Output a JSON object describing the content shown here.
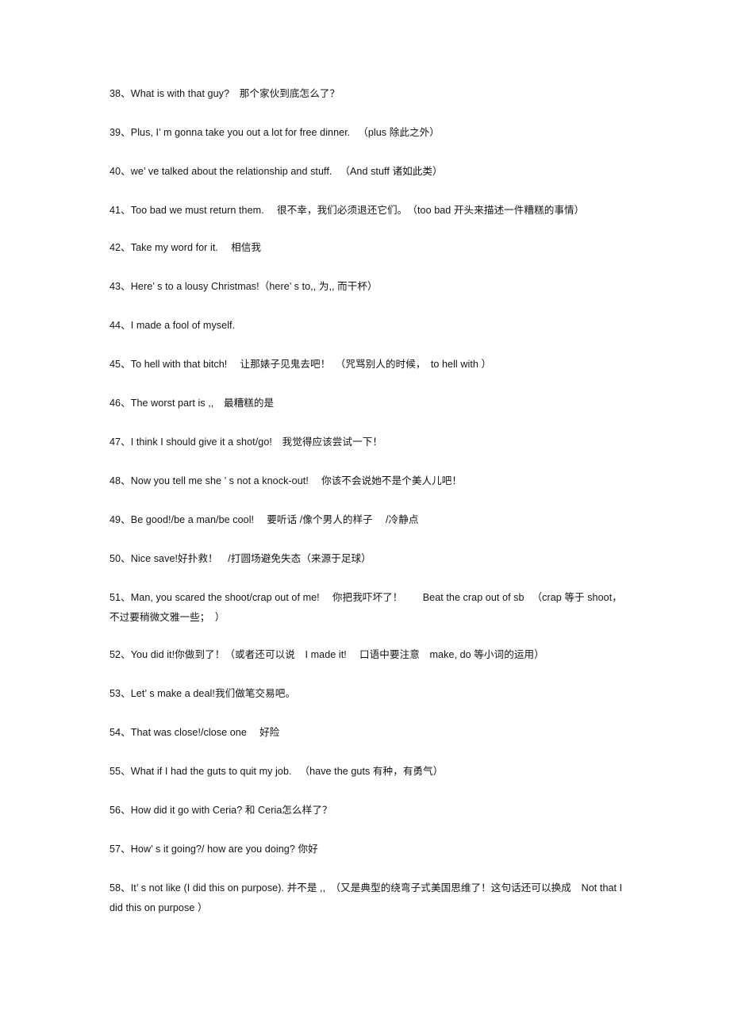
{
  "document": {
    "type": "phrasebook-page",
    "language": "en-zh",
    "background_color": "#ffffff",
    "text_color": "#141414",
    "entries": [
      {
        "number": "38",
        "text": "38、What is with that guy?　那个家伙到底怎么了？"
      },
      {
        "number": "39",
        "text": "39、Plus, I’ m gonna take you out a lot for free dinner. 　（plus 除此之外）"
      },
      {
        "number": "40",
        "text": "40、we’ ve talked about the relationship and stuff. 　（And stuff 诸如此类）"
      },
      {
        "number": "41",
        "text": "41、Too bad we must return them. 　很不幸，我们必须退还它们。　（too bad 开头来描述一件糟糕的事情）"
      },
      {
        "number": "42",
        "text": "42、Take my word for it. 　相信我"
      },
      {
        "number": "43",
        "text": "43、Here’ s to a lousy Christmas!（here’ s to,, 为,, 而干杯）"
      },
      {
        "number": "44",
        "text": "44、I made a fool of myself."
      },
      {
        "number": "45",
        "text": "45、To hell with that bitch! 　让那婊子见鬼去吧！　（咒骂别人的时候，　to hell with ）"
      },
      {
        "number": "46",
        "text": "46、The worst part is ,,　最糟糕的是"
      },
      {
        "number": "47",
        "text": "47、I think I should give it a shot/go!　我觉得应该尝试一下！"
      },
      {
        "number": "48",
        "text": "48、Now you tell me she ’ s not a knock-out! 　你该不会说她不是个美人儿吧！"
      },
      {
        "number": "49",
        "text": "49、Be good!/be a man/be cool! 　要听话 /像个男人的样子 　/冷静点"
      },
      {
        "number": "50",
        "text": "50、Nice save!好扑救！　/打圆场避免失态（来源于足球）"
      },
      {
        "number": "51",
        "text": "51、Man, you scared the shoot/crap out of me! 　你把我吓坏了！　　Beat the crap out of sb 　（crap 等于 shoot，不过要稍微文雅一些；　）"
      },
      {
        "number": "52",
        "text": "52、You did it!你做到了！（或者还可以说　I made it! 　口语中要注意　make, do 等小词的运用）"
      },
      {
        "number": "53",
        "text": "53、Let’ s make a deal!我们做笔交易吧。"
      },
      {
        "number": "54",
        "text": "54、That was close!/close one 　好险"
      },
      {
        "number": "55",
        "text": "55、What if I had the guts to quit my job. 　（have the guts 有种，有勇气）"
      },
      {
        "number": "56",
        "text": "56、How did it go with Ceria? 和 Ceria怎么样了？"
      },
      {
        "number": "57",
        "text": "57、How’ s it going?/ how are you doing? 你好"
      },
      {
        "number": "58",
        "text": "58、It’ s not like (I did this on purpose). 并不是 ,,　（又是典型的绕弯子式美国思维了！这句话还可以换成　Not that I did this on purpose ）"
      }
    ]
  }
}
